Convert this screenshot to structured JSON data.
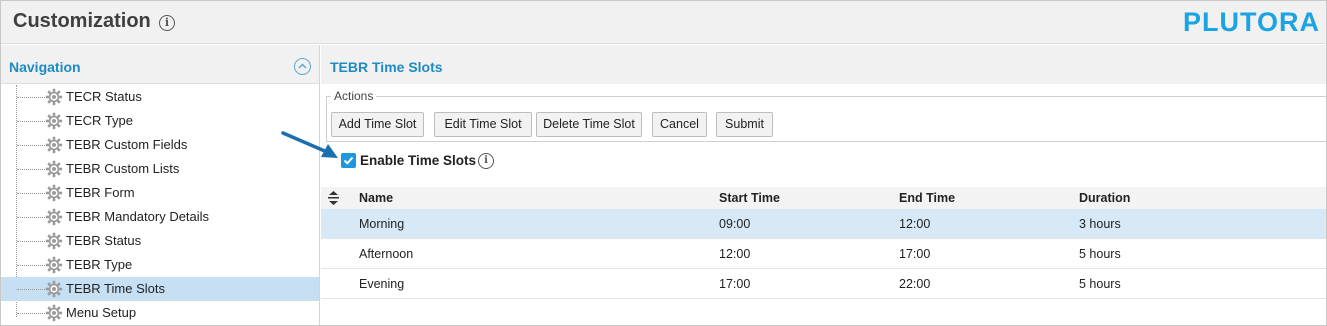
{
  "header": {
    "title": "Customization",
    "info_icon": "i",
    "logo": "PLUTORA"
  },
  "nav": {
    "title": "Navigation",
    "items": [
      {
        "label": "TECR Status",
        "icon": "gear-icon",
        "selected": false
      },
      {
        "label": "TECR Type",
        "icon": "gear-icon",
        "selected": false
      },
      {
        "label": "TEBR Custom Fields",
        "icon": "gear-icon",
        "selected": false
      },
      {
        "label": "TEBR Custom Lists",
        "icon": "gear-icon",
        "selected": false
      },
      {
        "label": "TEBR Form",
        "icon": "gear-icon",
        "selected": false
      },
      {
        "label": "TEBR Mandatory Details",
        "icon": "gear-icon",
        "selected": false
      },
      {
        "label": "TEBR Status",
        "icon": "gear-icon",
        "selected": false
      },
      {
        "label": "TEBR Type",
        "icon": "gear-icon",
        "selected": false
      },
      {
        "label": "TEBR Time Slots",
        "icon": "gear-icon",
        "selected": true
      },
      {
        "label": "Menu Setup",
        "icon": "gear-icon",
        "selected": false
      }
    ]
  },
  "main": {
    "title": "TEBR Time Slots",
    "actions": {
      "legend": "Actions",
      "buttons": [
        "Add Time Slot",
        "Edit Time Slot",
        "Delete Time Slot",
        "Cancel",
        "Submit"
      ]
    },
    "enable": {
      "label": "Enable Time Slots",
      "checked": true,
      "info_icon": "i"
    },
    "table": {
      "columns": [
        "Name",
        "Start Time",
        "End Time",
        "Duration"
      ],
      "rows": [
        {
          "name": "Morning",
          "start": "09:00",
          "end": "12:00",
          "duration": "3 hours",
          "selected": true
        },
        {
          "name": "Afternoon",
          "start": "12:00",
          "end": "17:00",
          "duration": "5 hours",
          "selected": false
        },
        {
          "name": "Evening",
          "start": "17:00",
          "end": "22:00",
          "duration": "5 hours",
          "selected": false
        }
      ]
    }
  },
  "colors": {
    "accent": "#1e8bc3",
    "logo": "#1ca3e3",
    "selected_row": "#d7e8f6",
    "selected_nav": "#c6dff2",
    "arrow": "#1b6fae"
  }
}
